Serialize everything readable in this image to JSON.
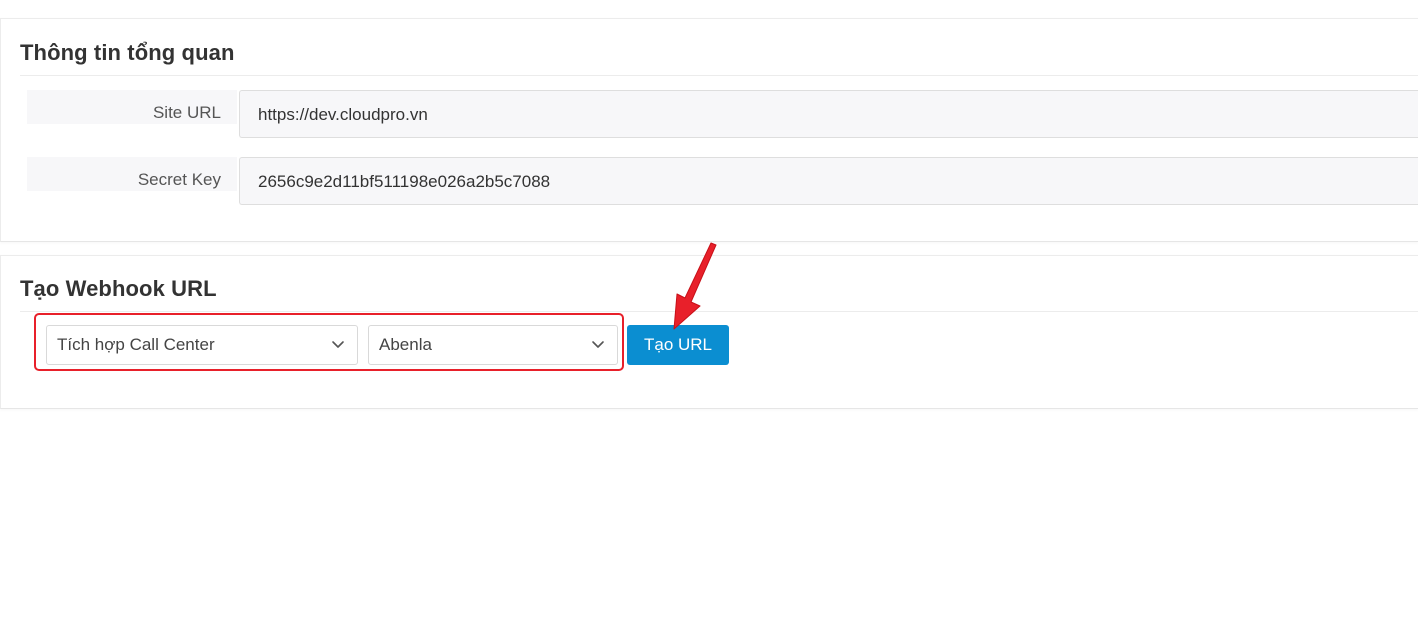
{
  "overview": {
    "title": "Thông tin tổng quan",
    "fields": [
      {
        "label": "Site URL",
        "value": "https://dev.cloudpro.vn"
      },
      {
        "label": "Secret Key",
        "value": "2656c9e2d11bf511198e026a2b5c7088"
      }
    ]
  },
  "webhook": {
    "title": "Tạo Webhook URL",
    "integration_select": {
      "selected": "Tích hợp Call Center"
    },
    "provider_select": {
      "selected": "Abenla"
    },
    "create_button_label": "Tạo URL"
  },
  "colors": {
    "primary_button": "#0b8ed1",
    "annotation_red": "#e8202a"
  },
  "icons": {
    "select_toggle": "chevron-down-icon",
    "annotation": "red-arrow-annotation"
  }
}
